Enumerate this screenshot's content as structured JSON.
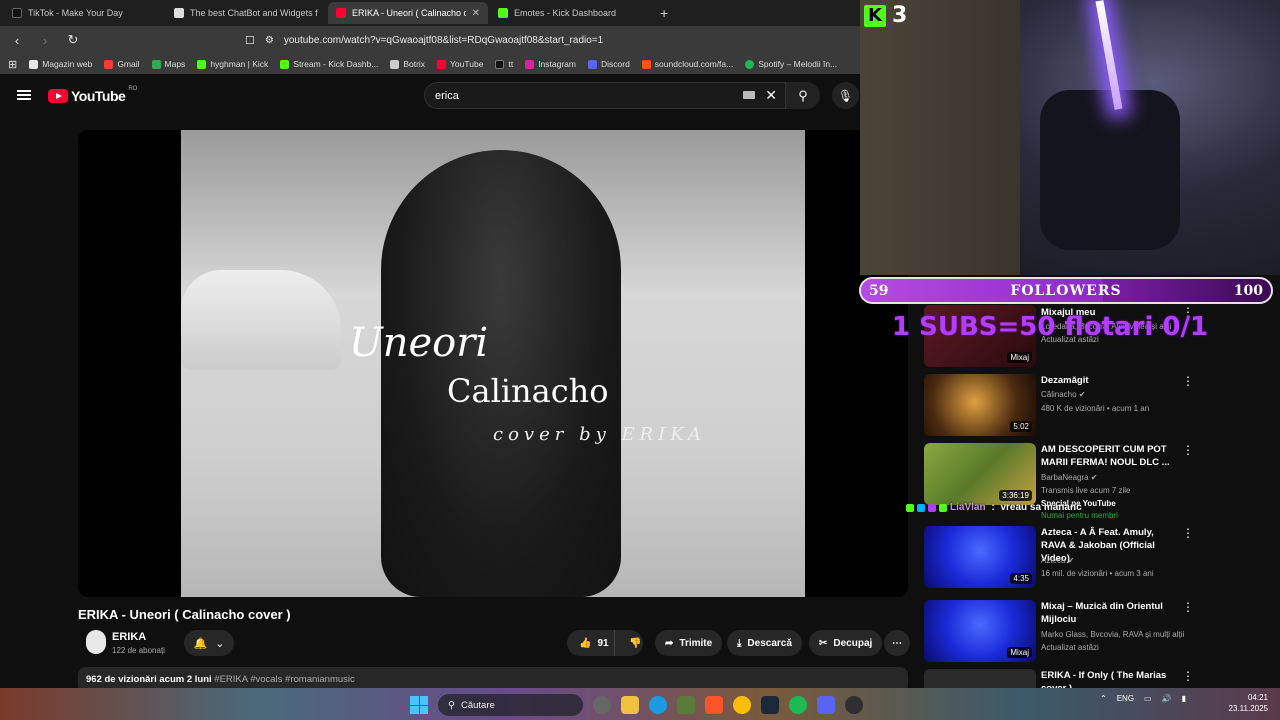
{
  "browser": {
    "tabs": [
      {
        "label": "TikTok - Make Your Day",
        "color": "#111111",
        "active": false
      },
      {
        "label": "The best ChatBot and Widgets for Kick",
        "color": "#dddddd",
        "active": false
      },
      {
        "label": "ERIKA - Uneori ( Calinacho cover )",
        "color": "#ff0033",
        "active": true
      },
      {
        "label": "Emotes - Kick Dashboard",
        "color": "#53fc18",
        "active": false
      }
    ],
    "new_tab": "+",
    "url": "youtube.com/watch?v=qGwaoajtf08&list=RDqGwaoajtf08&start_radio=1",
    "bookmarks": [
      {
        "label": "Magazin web",
        "color": "#e8e8e8"
      },
      {
        "label": "Gmail",
        "color": "#ea4335"
      },
      {
        "label": "Maps",
        "color": "#34a853"
      },
      {
        "label": "hyghman | Kick",
        "color": "#53fc18"
      },
      {
        "label": "Stream - Kick Dashb...",
        "color": "#53fc18"
      },
      {
        "label": "Botrix",
        "color": "#cccccc"
      },
      {
        "label": "YouTube",
        "color": "#ff0033"
      },
      {
        "label": "tt",
        "color": "#111111"
      },
      {
        "label": "Instagram",
        "color": "#d6249f"
      },
      {
        "label": "Discord",
        "color": "#5865f2"
      },
      {
        "label": "soundcloud.com/fa...",
        "color": "#ff5500"
      },
      {
        "label": "Spotify – Melodii în...",
        "color": "#1db954"
      }
    ]
  },
  "youtube": {
    "logo": "YouTube",
    "region": "RO",
    "search_value": "erica",
    "video_overlay": {
      "line1": "Uneori",
      "line2": "Calinacho",
      "line3": "cover by ERIKA"
    },
    "video_title": "ERIKA - Uneori ( Calinacho cover )",
    "channel": {
      "name": "ERIKA",
      "subs": "122 de abonați"
    },
    "actions": {
      "likes": "91",
      "share": "Trimite",
      "download": "Descarcă",
      "clip": "Decupaj"
    },
    "description": {
      "stats": "962 de vizionări  acum 2 luni ",
      "tags": "#ERIKA #vocals #romanianmusic"
    }
  },
  "sidebar": [
    {
      "title": "Mixajul meu",
      "meta1": "Loredana, Bvcovia, Alex Velea și alții",
      "meta2": "Actualizat astăzi",
      "dur": "Mixaj",
      "thumb": "#5a1a22"
    },
    {
      "title": "Dezamăgit",
      "meta1": "Călinacho ✔",
      "meta2": "480 K de vizionări • acum 1 an",
      "dur": "5:02",
      "thumb": "#6a4a1a"
    },
    {
      "title": "AM DESCOPERIT CUM POT MARII FERMA! NOUL DLC ...",
      "meta1": "BarbaNeagra ✔",
      "meta2": "Transmis live acum 7 zile",
      "meta3": "Special pe YouTube",
      "meta4": "Numai pentru membri",
      "dur": "3:36:19",
      "thumb": "#7a8a3a"
    },
    {
      "title": "Azteca - A Â Feat. Amuly, RAVA & Jakoban (Official Video)",
      "meta1": "Azteca ✔",
      "meta2": "16 mil. de vizionări • acum 3 ani",
      "dur": "4:35",
      "thumb": "#1a2ad8"
    },
    {
      "title": "Mixaj – Muzică din Orientul Mijlociu",
      "meta1": "Marko Glass, Bvcovia, RAVA și mulți alții",
      "meta2": "Actualizat astăzi",
      "dur": "Mixaj",
      "thumb": "#1a2ad8"
    },
    {
      "title": "ERIKA - If Only ( The Marias cover )",
      "meta1": "",
      "meta2": "",
      "dur": "",
      "thumb": "#2a2a2a"
    }
  ],
  "overlay": {
    "kick_count": "3",
    "goal": {
      "current": "59",
      "label": "FOLLOWERS",
      "max": "100",
      "fraction": 0.59
    },
    "subs_goal": "1 SUBS=50 flotari 0/1",
    "chat": {
      "user": "LiaVlan",
      "sep": " : ",
      "message": "vreau sa mananc"
    }
  },
  "taskbar": {
    "search": "Căutare",
    "lang": "ENG",
    "time": "04:21",
    "date": "23.11.2025"
  }
}
